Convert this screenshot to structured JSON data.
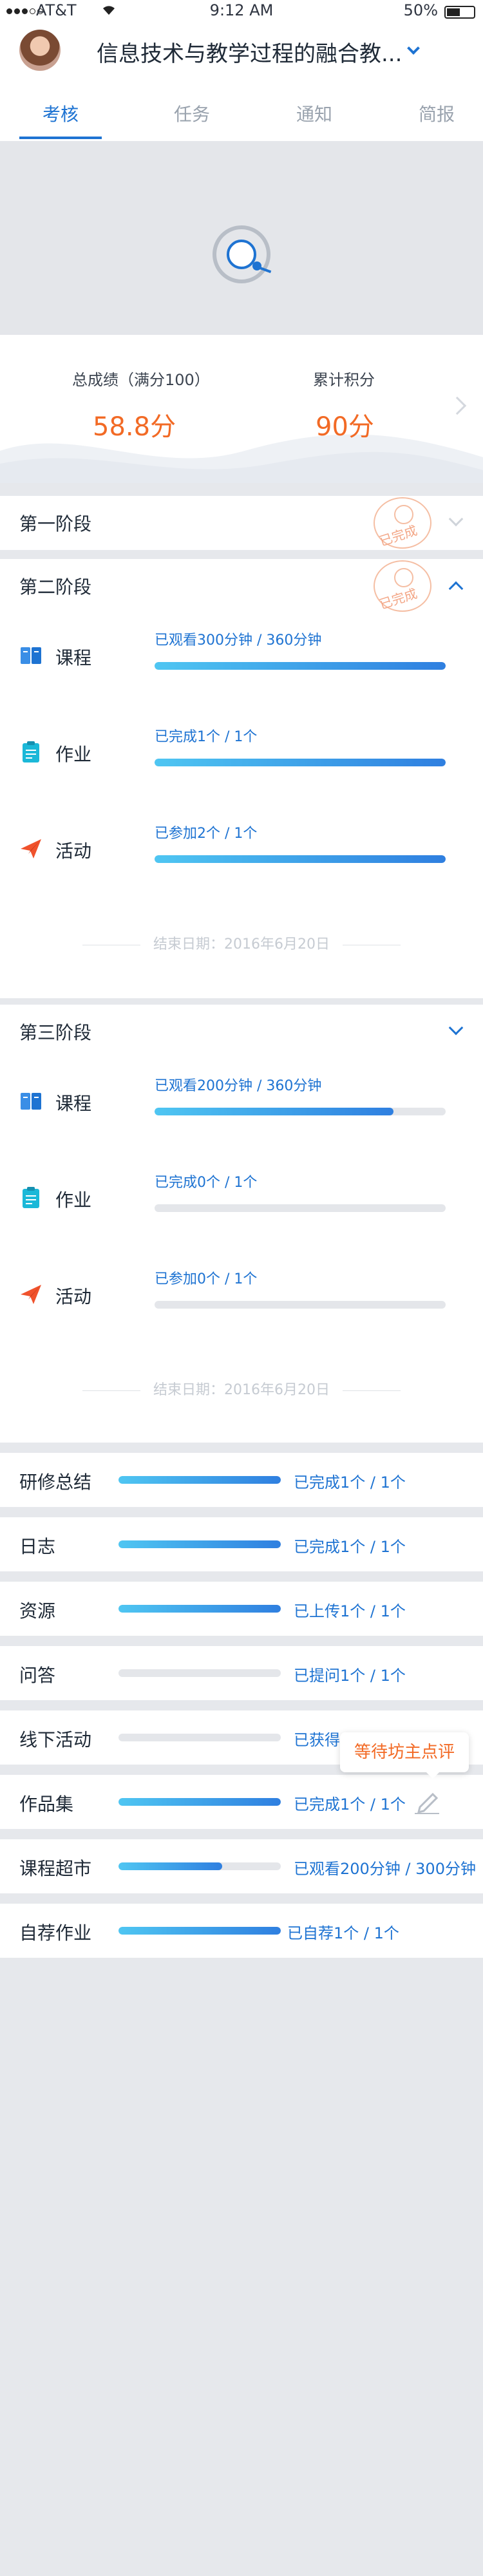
{
  "status_bar": {
    "carrier": "AT&T",
    "time": "9:12 AM",
    "battery": "50%"
  },
  "header": {
    "title": "信息技术与教学过程的融合教..."
  },
  "tabs": [
    {
      "label": "考核",
      "active": true
    },
    {
      "label": "任务"
    },
    {
      "label": "通知"
    },
    {
      "label": "简报"
    }
  ],
  "score": {
    "total_label": "总成绩（满分100）",
    "total_value": "58.8分",
    "points_label": "累计积分",
    "points_value": "90分"
  },
  "stages": [
    {
      "name": "第一阶段",
      "stamp": "已完成",
      "expanded": false
    },
    {
      "name": "第二阶段",
      "stamp": "已完成",
      "expanded": true,
      "items": [
        {
          "name": "课程",
          "icon": "book-icon",
          "status": "已观看300分钟 / 360分钟",
          "progress": 1.0
        },
        {
          "name": "作业",
          "icon": "clipboard-icon",
          "status": "已完成1个 / 1个",
          "progress": 1.0
        },
        {
          "name": "活动",
          "icon": "paper-plane-icon",
          "status": "已参加2个 / 1个",
          "progress": 1.0
        }
      ],
      "end_date": "结束日期：2016年6月20日"
    },
    {
      "name": "第三阶段",
      "expanded": true,
      "items": [
        {
          "name": "课程",
          "icon": "book-icon",
          "status": "已观看200分钟 / 360分钟",
          "progress": 0.82
        },
        {
          "name": "作业",
          "icon": "clipboard-icon",
          "status": "已完成0个 / 1个",
          "progress": 0
        },
        {
          "name": "活动",
          "icon": "paper-plane-icon",
          "status": "已参加0个 / 1个",
          "progress": 0
        }
      ],
      "end_date": "结束日期：2016年6月20日"
    }
  ],
  "summary": [
    {
      "name": "研修总结",
      "status": "已完成1个 / 1个",
      "progress": 1.0
    },
    {
      "name": "日志",
      "status": "已完成1个 / 1个",
      "progress": 1.0
    },
    {
      "name": "资源",
      "status": "已上传1个 / 1个",
      "progress": 1.0
    },
    {
      "name": "问答",
      "status": "已提问1个 / 1个",
      "progress": 0
    },
    {
      "name": "线下活动",
      "status": "已获得",
      "progress": 0
    },
    {
      "name": "作品集",
      "status": "已完成1个 / 1个",
      "progress": 1.0
    },
    {
      "name": "课程超市",
      "status": "已观看200分钟 / 300分钟",
      "progress": 0.64
    },
    {
      "name": "自荐作业",
      "status": "已自荐1个 / 1个",
      "progress": 1.0
    }
  ],
  "tooltip": {
    "text": "等待坊主点评"
  },
  "colors": {
    "accent": "#1e73d2",
    "orange": "#f26a25",
    "bar_start": "#4fc6f2",
    "bar_end": "#2f7fe0"
  }
}
